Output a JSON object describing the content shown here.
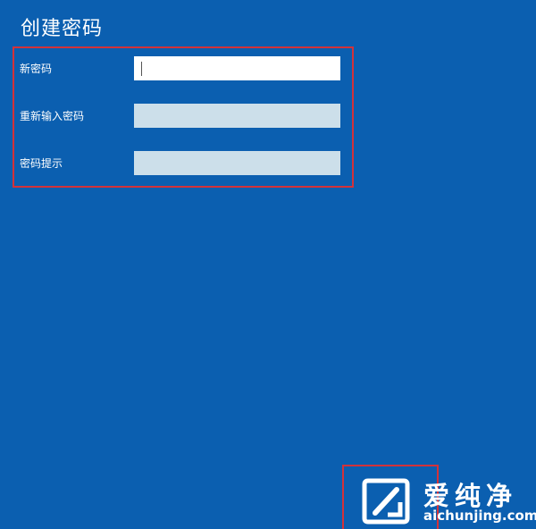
{
  "header": {
    "title": "创建密码"
  },
  "form": {
    "fields": [
      {
        "label": "新密码",
        "value": ""
      },
      {
        "label": "重新输入密码",
        "value": ""
      },
      {
        "label": "密码提示",
        "value": ""
      }
    ]
  },
  "watermark": {
    "name": "爱纯净",
    "url": "aichunjing.com"
  },
  "colors": {
    "background": "#0b5fb0",
    "highlight_border": "#d3323a",
    "active_input": "#ffffff",
    "inactive_input": "#ccdfea"
  },
  "icons": {
    "logo": "aichunjing-logo-icon"
  }
}
